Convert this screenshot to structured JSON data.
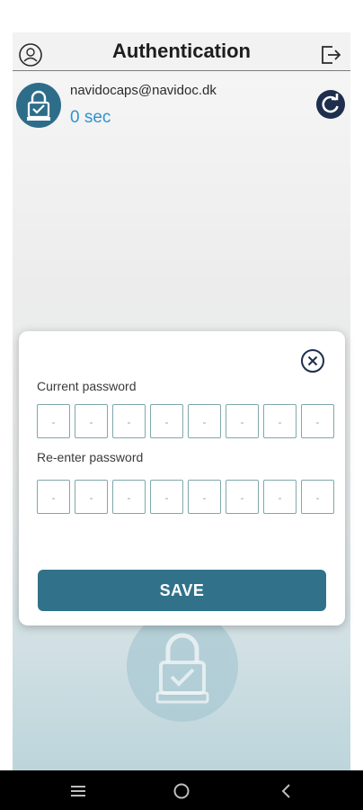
{
  "header": {
    "title": "Authentication",
    "profile_icon": "user-circle-icon",
    "logout_icon": "logout-icon"
  },
  "account": {
    "email": "navidocaps@navidoc.dk",
    "timer": "0 sec",
    "avatar_icon": "lock-check-icon",
    "refresh_icon": "refresh-icon"
  },
  "dialog": {
    "close_icon": "close-circle-icon",
    "current_label": "Current password",
    "reenter_label": "Re-enter password",
    "current_pin": [
      "-",
      "-",
      "-",
      "-",
      "-",
      "-",
      "-",
      "-"
    ],
    "reenter_pin": [
      "-",
      "-",
      "-",
      "-",
      "-",
      "-",
      "-",
      "-"
    ],
    "save_label": "SAVE"
  },
  "navbar": {
    "items": [
      "menu-icon",
      "home-circle-icon",
      "back-icon"
    ]
  },
  "colors": {
    "accent": "#31728a",
    "timer": "#2e93cf",
    "refresh_bg": "#1f2e4c",
    "pin_border": "#7fa8ab"
  }
}
